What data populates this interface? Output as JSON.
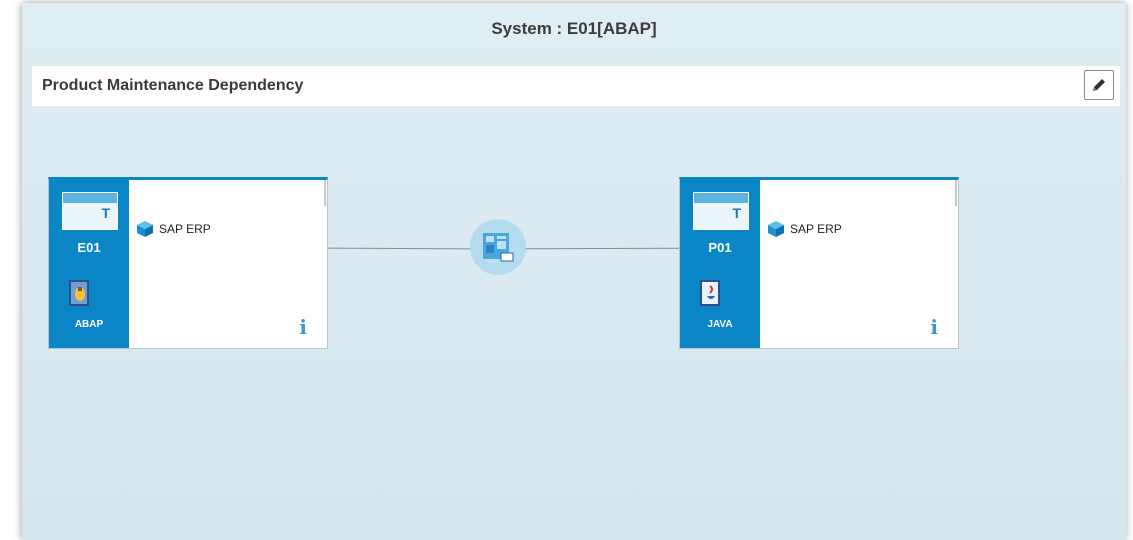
{
  "system_title": "System : E01[ABAP]",
  "section_title": "Product Maintenance Dependency",
  "edit_icon": "pencil-icon",
  "colors": {
    "accent": "#0a86c6",
    "info": "#3a9ad6",
    "background": "#dbeaf0"
  },
  "nodes": [
    {
      "sid": "E01",
      "type": "ABAP",
      "product": "SAP ERP",
      "info_label": "i",
      "type_icon": "abap-system-icon",
      "product_icon": "product-cube-icon"
    },
    {
      "sid": "P01",
      "type": "JAVA",
      "product": "SAP ERP",
      "info_label": "i",
      "type_icon": "java-system-icon",
      "product_icon": "product-cube-icon"
    }
  ],
  "hub_icon": "maintenance-dependency-icon"
}
